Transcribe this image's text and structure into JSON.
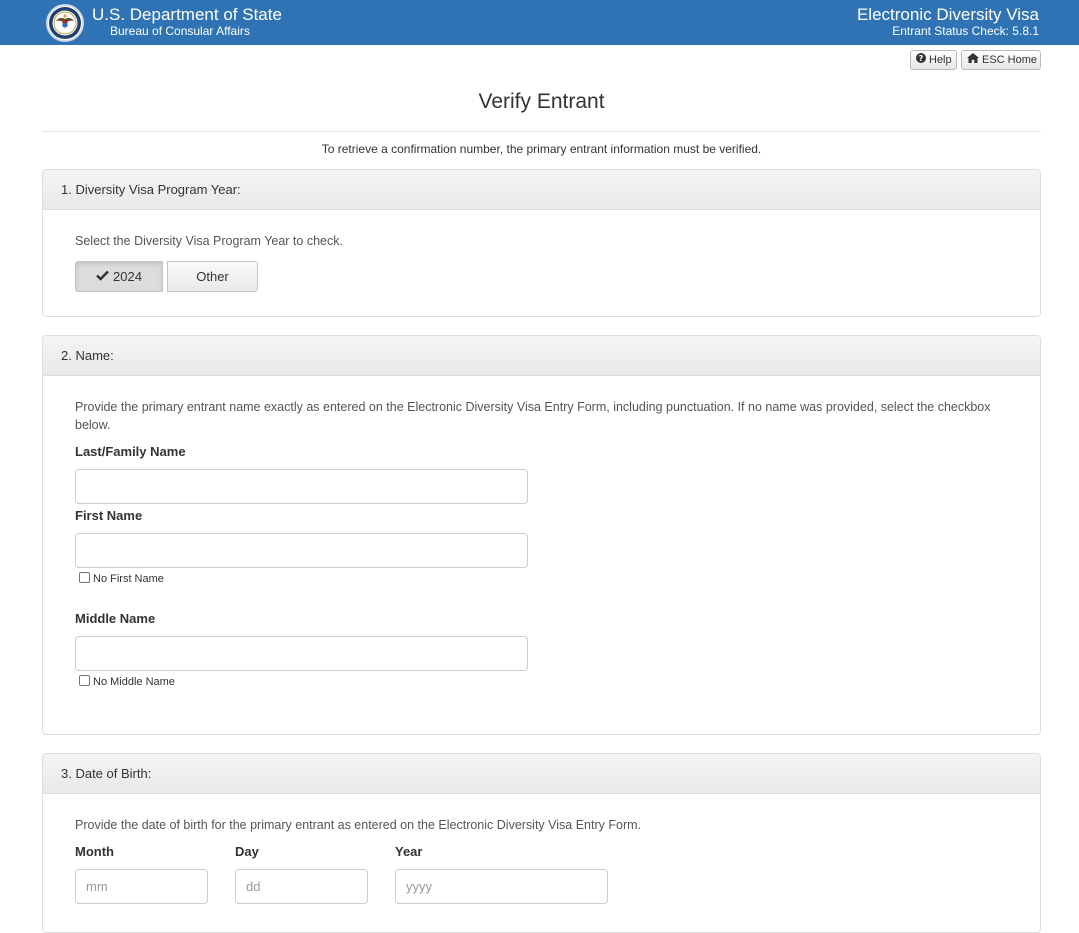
{
  "header": {
    "agency": "U.S. Department of State",
    "bureau": "Bureau of Consular Affairs",
    "app_title": "Electronic Diversity Visa",
    "app_version": "Entrant Status Check: 5.8.1",
    "brand_color": "#2f73b4"
  },
  "utility": {
    "help_label": "Help",
    "home_label": "ESC Home"
  },
  "page": {
    "title": "Verify Entrant",
    "intro": "To retrieve a confirmation number, the primary entrant information must be verified."
  },
  "section1": {
    "heading": "1. Diversity Visa Program Year:",
    "help": "Select the Diversity Visa Program Year to check.",
    "options": [
      "2024",
      "Other"
    ],
    "selected": "2024"
  },
  "section2": {
    "heading": "2. Name:",
    "help": "Provide the primary entrant name exactly as entered on the Electronic Diversity Visa Entry Form, including punctuation. If no name was provided, select the checkbox below.",
    "last_label": "Last/Family Name",
    "last_value": "",
    "first_label": "First Name",
    "first_value": "",
    "no_first_label": "No First Name",
    "no_first_checked": false,
    "middle_label": "Middle Name",
    "middle_value": "",
    "no_middle_label": "No Middle Name",
    "no_middle_checked": false
  },
  "section3": {
    "heading": "3. Date of Birth:",
    "help": "Provide the date of birth for the primary entrant as entered on the Electronic Diversity Visa Entry Form.",
    "month_label": "Month",
    "month_placeholder": "mm",
    "day_label": "Day",
    "day_placeholder": "dd",
    "year_label": "Year",
    "year_placeholder": "yyyy"
  }
}
